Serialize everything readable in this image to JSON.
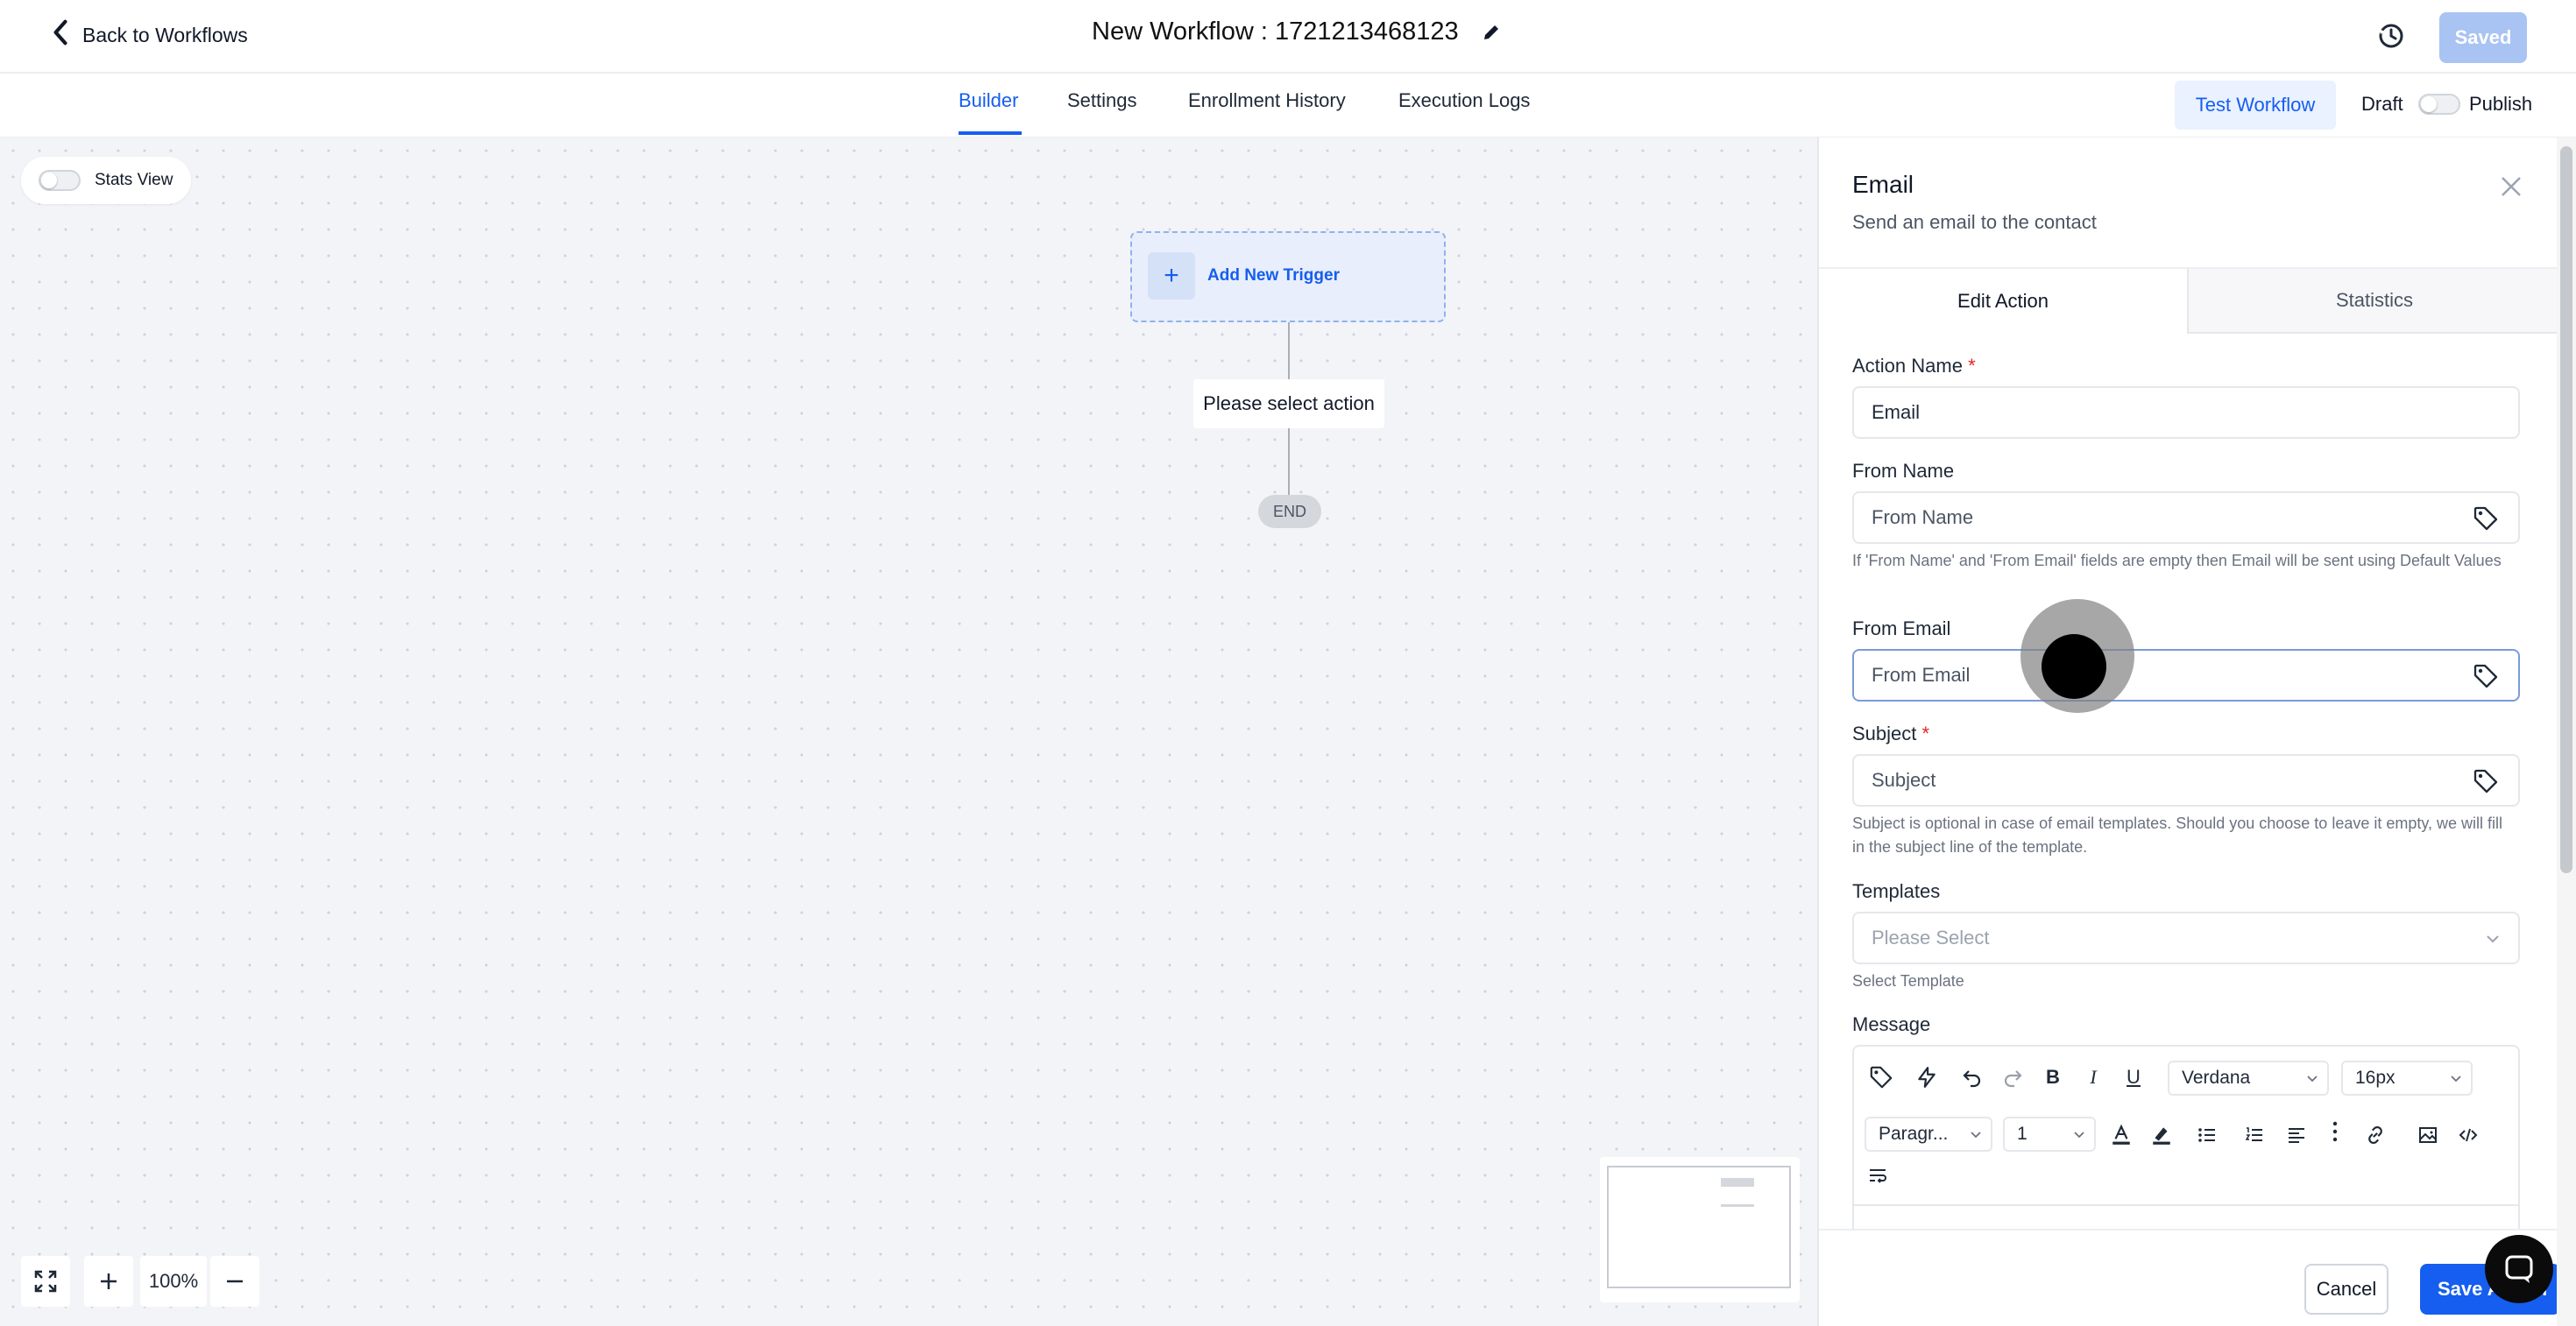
{
  "header": {
    "back_label": "Back to Workflows",
    "title": "New Workflow : 1721213468123",
    "saved_label": "Saved"
  },
  "tabs": [
    {
      "label": "Builder",
      "active": true
    },
    {
      "label": "Settings"
    },
    {
      "label": "Enrollment History"
    },
    {
      "label": "Execution Logs"
    }
  ],
  "actions": {
    "test_label": "Test Workflow",
    "draft_label": "Draft",
    "publish_label": "Publish",
    "publish_enabled": false
  },
  "canvas": {
    "stats_view_label": "Stats View",
    "stats_view_enabled": false,
    "trigger_label": "Add New Trigger",
    "select_action_label": "Please select action",
    "end_label": "END",
    "zoom_level": "100%"
  },
  "panel": {
    "title": "Email",
    "subtitle": "Send an email to the contact",
    "tabs": {
      "edit": "Edit Action",
      "stats": "Statistics"
    },
    "fields": {
      "action_name": {
        "label": "Action Name",
        "required_mark": "*",
        "value": "Email"
      },
      "from_name": {
        "label": "From Name",
        "placeholder": "From Name",
        "hint": "If 'From Name' and 'From Email' fields are empty then Email will be sent using Default Values"
      },
      "from_email": {
        "label": "From Email",
        "placeholder": "From Email"
      },
      "subject": {
        "label": "Subject",
        "required_mark": "*",
        "placeholder": "Subject",
        "hint": "Subject is optional in case of email templates. Should you choose to leave it empty, we will fill in the subject line of the template."
      },
      "templates": {
        "label": "Templates",
        "placeholder": "Please Select",
        "hint": "Select Template"
      },
      "message": {
        "label": "Message"
      }
    },
    "editor_toolbar": {
      "font_family": "Verdana",
      "font_size": "16px",
      "block_format": "Paragr...",
      "line_height": "1"
    },
    "footer": {
      "cancel_label": "Cancel",
      "save_label": "Save Action"
    }
  },
  "colors": {
    "accent": "#155eef",
    "saved_button": "#a9c3f3",
    "canvas_bg": "#f3f4f8",
    "required": "#e02424"
  },
  "icons": [
    "chevron-left-icon",
    "pencil-icon",
    "history-icon",
    "plus-icon",
    "close-icon",
    "tag-icon",
    "chevron-down-icon",
    "lightning-icon",
    "undo-icon",
    "redo-icon",
    "bold-icon",
    "italic-icon",
    "underline-icon",
    "text-color-icon",
    "highlight-icon",
    "bullet-list-icon",
    "numbered-list-icon",
    "align-icon",
    "more-icon",
    "link-icon",
    "image-icon",
    "code-icon",
    "format-clear-icon",
    "fullscreen-icon",
    "minus-icon",
    "chat-icon"
  ]
}
